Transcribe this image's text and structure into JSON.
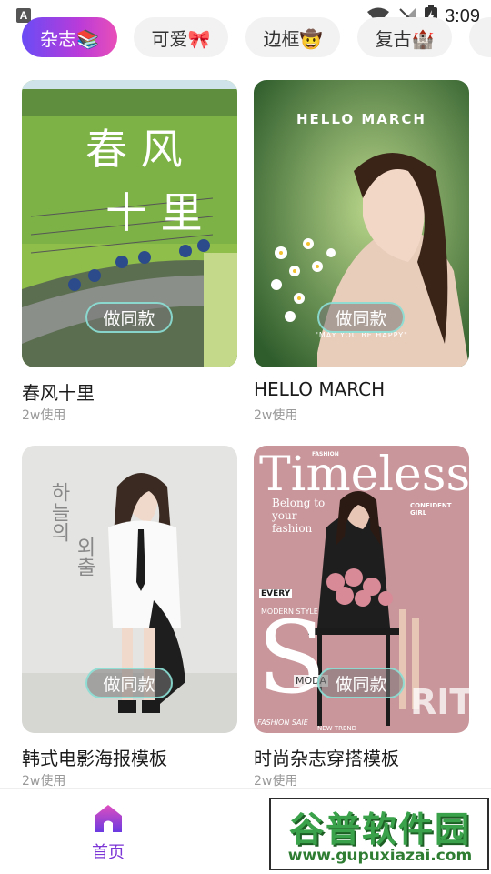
{
  "status_bar": {
    "time": "3:09",
    "icons": [
      "a-notification-icon",
      "wifi-icon",
      "signal-off-icon",
      "battery-charging-icon"
    ]
  },
  "tabs": [
    {
      "label": "杂志📚",
      "active": true
    },
    {
      "label": "可爱🎀",
      "active": false
    },
    {
      "label": "边框🤠",
      "active": false
    },
    {
      "label": "复古🏰",
      "active": false
    }
  ],
  "cards": [
    {
      "title": "春风十里",
      "usage": "2w使用",
      "button": "做同款",
      "overlay": [
        "春 风",
        "十 里"
      ]
    },
    {
      "title": "HELLO MARCH",
      "usage": "2w使用",
      "button": "做同款",
      "overlay": [
        "HELLO MARCH",
        "\"MAY YOU BE HAPPY\""
      ]
    },
    {
      "title": "韩式电影海报模板",
      "usage": "2w使用",
      "button": "做同款",
      "overlay": [
        "하늘의",
        "외출"
      ]
    },
    {
      "title": "时尚杂志穿搭模板",
      "usage": "2w使用",
      "button": "做同款",
      "overlay": [
        "Timeless",
        "Belong to your fashion",
        "FASHION",
        "EVERY",
        "MODERN STYLE",
        "S",
        "RITE",
        "MODA",
        "FASHION SAIE",
        "NEW TREND",
        "CONFIDENT GIRL"
      ]
    }
  ],
  "bottom_nav": {
    "home_label": "首页"
  },
  "watermark": {
    "title": "谷普软件园",
    "url": "www.gupuxiazai.com"
  },
  "colors": {
    "accent_start": "#6a4cf5",
    "accent_end": "#e94fb8",
    "home_active": "#7b34d6"
  }
}
